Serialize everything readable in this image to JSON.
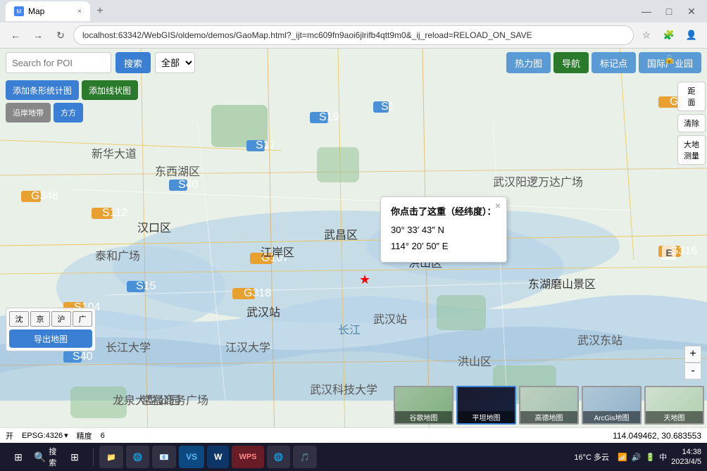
{
  "browser": {
    "tab_title": "Map",
    "tab_close": "×",
    "tab_new": "+",
    "back": "←",
    "forward": "→",
    "refresh": "↻",
    "home": "⌂",
    "url": "localhost:63342/WebGIS/oldemo/demos/GaoMap.html?_ijt=mc609fn9aoi6jlrifb4qtt9m0&_ij_reload=RELOAD_ON_SAVE",
    "bookmark": "☆",
    "extensions": "🧩",
    "profile": "👤"
  },
  "toolbar": {
    "search_placeholder": "Search for POI",
    "search_btn": "搜索",
    "select_option": "全部",
    "add_shape_btn": "添加条形统计图",
    "add_line_btn": "添加线状图",
    "heatmap_btn": "热力图",
    "nav_btn": "导航",
    "marker_btn": "标记点",
    "property_btn": "国际产业园"
  },
  "left_panel": {
    "export_label": "导出地图",
    "coord_btns": [
      "沈",
      "京",
      "沪",
      "广"
    ]
  },
  "right_panel": {
    "distance_label": "距\n面",
    "clear_label": "清除",
    "earth_label": "大地\n测量",
    "zoom_in": "+",
    "zoom_out": "-",
    "compass": "E"
  },
  "popup": {
    "title": "你点击了这重（经纬度）：",
    "lat_deg": "30°",
    "lat_min": "33′",
    "lat_sec": "43″",
    "lat_dir": "N",
    "lon_deg": "114°",
    "lon_min": "20′",
    "lon_sec": "50″",
    "lon_dir": "E",
    "close": "×"
  },
  "status_bar": {
    "power": "开",
    "epsg": "EPSG:4326",
    "precision_label": "精度",
    "precision_value": "6",
    "coordinates": "114.049462, 30.683553"
  },
  "map_thumbnails": [
    {
      "label": "谷歌地图",
      "active": false
    },
    {
      "label": "平坦地图",
      "active": true
    },
    {
      "label": "高德地图",
      "active": false
    },
    {
      "label": "ArcGis地图",
      "active": false
    },
    {
      "label": "天地图",
      "active": false
    }
  ],
  "taskbar": {
    "start_icon": "⊞",
    "search_btn": "🔍",
    "search_label": "搜索",
    "weather": "16°C 多云",
    "time": "14:38",
    "date": "2023/4/5",
    "tray_icons": "中 中 (5)Bk|@Arc"
  },
  "taskbar_apps": [
    {
      "icon": "📁",
      "label": ""
    },
    {
      "icon": "🌐",
      "label": ""
    },
    {
      "icon": "📧",
      "label": ""
    },
    {
      "icon": "VS",
      "label": ""
    },
    {
      "icon": "W",
      "label": ""
    },
    {
      "icon": "WPS",
      "label": ""
    },
    {
      "icon": "🌐",
      "label": ""
    },
    {
      "icon": "🎵",
      "label": ""
    }
  ]
}
